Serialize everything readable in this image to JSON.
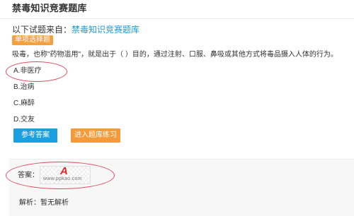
{
  "header": {
    "title": "禁毒知识竞赛题库"
  },
  "source": {
    "prefix": "以下试题来自：",
    "link_text": "禁毒知识竞赛题库"
  },
  "question": {
    "type_badge": "单项选择题",
    "text": "吸毒，也称\"药物滥用\"，就是出于（ ）目的，通过注射、口服、鼻吸或其他方式将毒品摄入人体的行为。",
    "options": [
      {
        "label": "A.非医疗"
      },
      {
        "label": "B.治病"
      },
      {
        "label": "C.麻醉"
      },
      {
        "label": "D.交友"
      }
    ]
  },
  "buttons": {
    "reference_answer": "参考答案",
    "enter_practice": "进入题库练习"
  },
  "answer": {
    "label": "答案：",
    "watermark_letter": "A",
    "watermark_url": "www.ppkao.com"
  },
  "analysis": {
    "text": "解析：暂无解析"
  },
  "colors": {
    "link": "#1a9bd7",
    "badge": "#f5a03c",
    "primary_button": "#1aa0e0",
    "secondary_button": "#f59a3a",
    "highlight_ellipse": "#e0495a"
  }
}
